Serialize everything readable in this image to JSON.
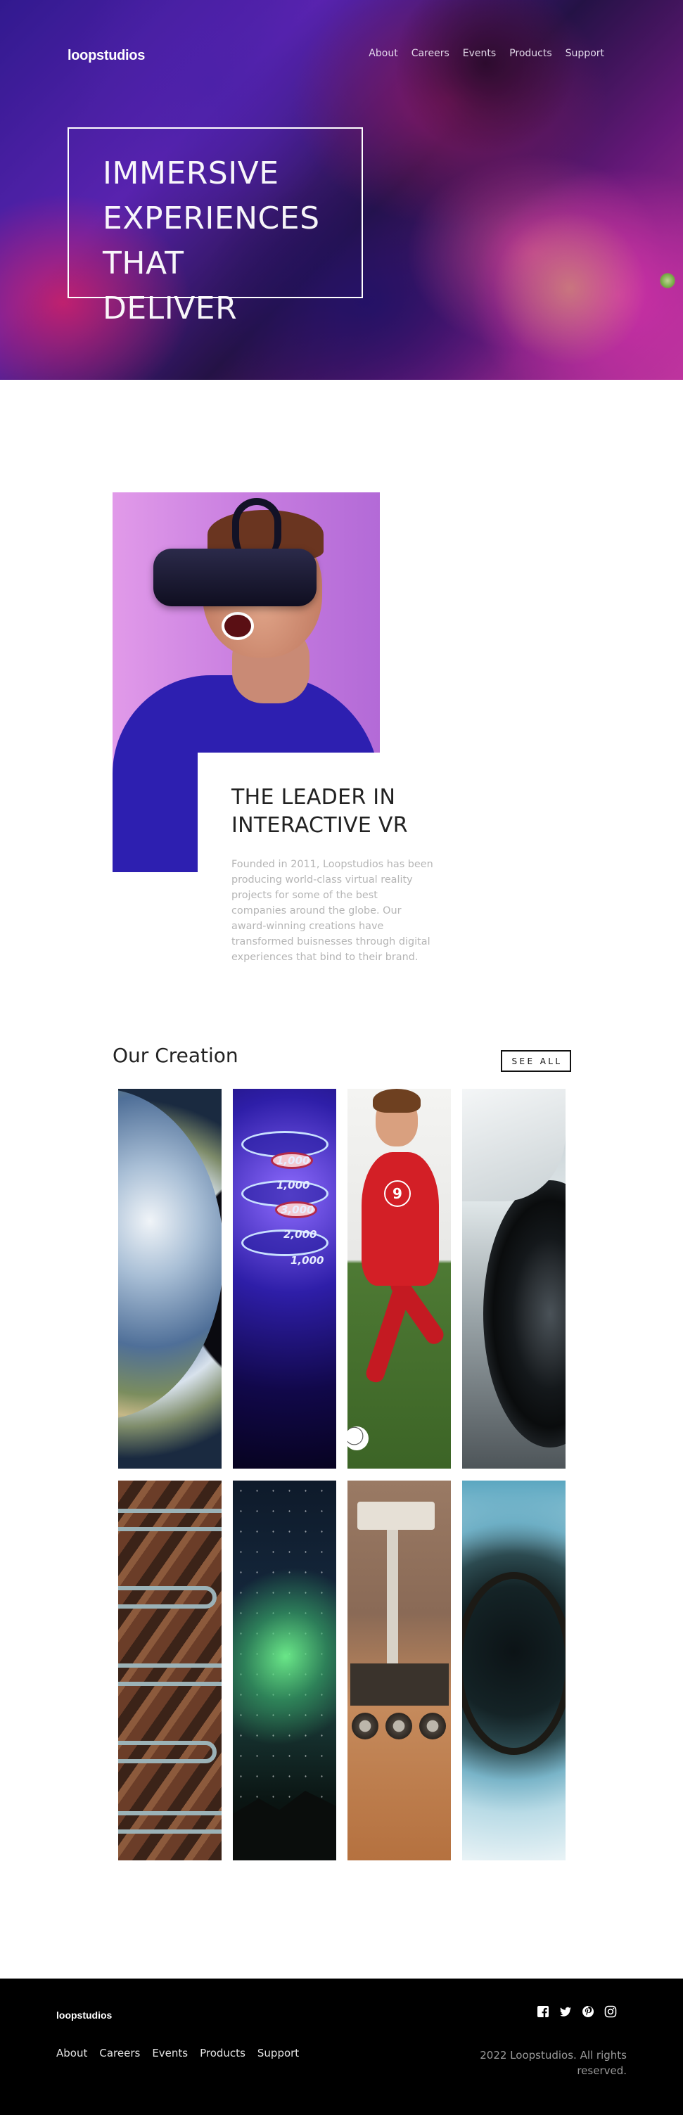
{
  "header": {
    "logo": "loopstudios",
    "nav": [
      "About",
      "Careers",
      "Events",
      "Products",
      "Support"
    ]
  },
  "hero": {
    "headline_lines": [
      "IMMERSIVE",
      "EXPERIENCES",
      "THAT DELIVER"
    ]
  },
  "interactive": {
    "title_lines": [
      "THE LEADER IN",
      "INTERACTIVE VR"
    ],
    "body": "Founded in 2011, Loopstudios has been producing world-class virtual reality projects for some of the best companies around the globe. Our award-winning creations have transformed buisnesses through digital experiences that bind to their brand."
  },
  "creations": {
    "title": "Our Creation",
    "see_all": "SEE ALL",
    "items": [
      {
        "name": "earth-image",
        "subject": "earth"
      },
      {
        "name": "arcade-image",
        "subject": "arcade"
      },
      {
        "name": "soccer-image",
        "subject": "soccer"
      },
      {
        "name": "car-image",
        "subject": "car"
      },
      {
        "name": "road-image",
        "subject": "road"
      },
      {
        "name": "aurora-image",
        "subject": "aurora"
      },
      {
        "name": "rover-image",
        "subject": "rover"
      },
      {
        "name": "planet-image",
        "subject": "planet"
      }
    ],
    "arcade_numbers": [
      "1,000",
      "1,000",
      "3,000",
      "2,000",
      "1,000"
    ]
  },
  "footer": {
    "logo": "loopstudios",
    "nav": [
      "About",
      "Careers",
      "Events",
      "Products",
      "Support"
    ],
    "social": [
      "facebook-icon",
      "twitter-icon",
      "pinterest-icon",
      "instagram-icon"
    ],
    "copyright": "2022 Loopstudios. All rights reserved."
  },
  "colors": {
    "hero_accent": "#e03fb8",
    "footer_bg": "#000000",
    "text_muted": "#b5b5b5"
  }
}
